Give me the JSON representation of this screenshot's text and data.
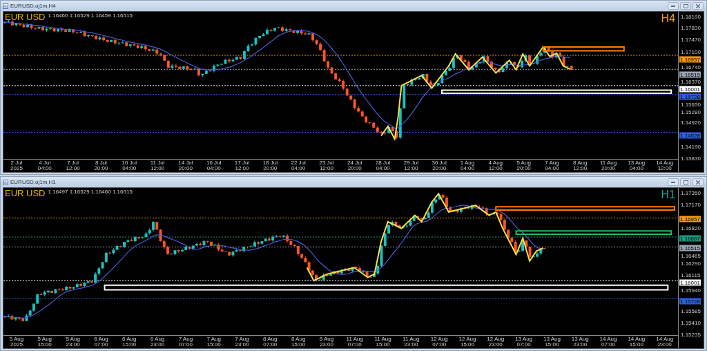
{
  "windows": [
    {
      "title": "EURUSD.oj1m,H4",
      "symbol": "EUR USD",
      "ohlc": "1.16460 1.16529 1.16459 1.16515",
      "timeframe": "H4",
      "price_axis": [
        {
          "kind": "tick",
          "value": "1.18190"
        },
        {
          "kind": "tick",
          "value": "1.17830"
        },
        {
          "kind": "tick",
          "value": "1.17470"
        },
        {
          "kind": "tick",
          "value": "1.17100"
        },
        {
          "kind": "tag",
          "value": "1.16957",
          "color": "#f59a00"
        },
        {
          "kind": "tick",
          "value": "1.16740"
        },
        {
          "kind": "tag",
          "value": "1.16515",
          "color": "#9aa4b4"
        },
        {
          "kind": "tick",
          "value": "1.16370"
        },
        {
          "kind": "tag",
          "value": "1.16001",
          "color": "#ffffff"
        },
        {
          "kind": "tag",
          "value": "1.15728",
          "color": "#2f5fe0"
        },
        {
          "kind": "tick",
          "value": "1.15650"
        },
        {
          "kind": "tick",
          "value": "1.15280"
        },
        {
          "kind": "tick",
          "value": "1.14920"
        },
        {
          "kind": "tag",
          "value": "1.14528",
          "color": "#2f5fe0"
        },
        {
          "kind": "tick",
          "value": "1.14190"
        },
        {
          "kind": "tick",
          "value": "1.13830"
        }
      ],
      "time_axis": [
        "2 Jul 2025",
        "4 Jul 04:00",
        "7 Jul 12:00",
        "8 Jul 20:00",
        "10 Jul 04:00",
        "11 Jul 12:00",
        "14 Jul 20:00",
        "16 Jul 04:00",
        "17 Jul 12:00",
        "18 Jul 20:00",
        "22 Jul 04:00",
        "23 Jul 12:00",
        "24 Jul 20:00",
        "28 Jul 04:00",
        "29 Jul 12:00",
        "30 Jul 20:00",
        "1 Aug 04:00",
        "4 Aug 12:00",
        "5 Aug 20:00",
        "7 Aug 04:00",
        "8 Aug 12:00",
        "11 Aug 20:00",
        "13 Aug 04:00",
        "14 Aug 12:00"
      ]
    },
    {
      "title": "EURUSD.oj1m,H1",
      "symbol": "EUR USD",
      "ohlc": "1.16497 1.16529 1.16460 1.16515",
      "timeframe": "H1",
      "price_axis": [
        {
          "kind": "tick",
          "value": "1.17350"
        },
        {
          "kind": "tick",
          "value": "1.17170"
        },
        {
          "kind": "tag",
          "value": "1.16957",
          "color": "#f59a00"
        },
        {
          "kind": "tick",
          "value": "1.16820"
        },
        {
          "kind": "tag",
          "value": "1.16667",
          "color": "#1a9a80"
        },
        {
          "kind": "tag",
          "value": "1.16515",
          "color": "#9aa4b4"
        },
        {
          "kind": "tick",
          "value": "1.16465"
        },
        {
          "kind": "tick",
          "value": "1.16290"
        },
        {
          "kind": "tick",
          "value": "1.16115"
        },
        {
          "kind": "tag",
          "value": "1.16001",
          "color": "#ffffff"
        },
        {
          "kind": "tick",
          "value": "1.15940"
        },
        {
          "kind": "tag",
          "value": "1.15728",
          "color": "#2f5fe0"
        },
        {
          "kind": "tick",
          "value": "1.15585"
        },
        {
          "kind": "tick",
          "value": "1.15410"
        },
        {
          "kind": "tick",
          "value": "1.15235"
        }
      ],
      "time_axis": [
        "5 Aug 2025",
        "5 Aug 15:00",
        "5 Aug 23:00",
        "6 Aug 07:00",
        "6 Aug 15:00",
        "6 Aug 23:00",
        "7 Aug 07:00",
        "7 Aug 15:00",
        "7 Aug 23:00",
        "8 Aug 07:00",
        "8 Aug 15:00",
        "8 Aug 23:00",
        "11 Aug 07:00",
        "11 Aug 15:00",
        "11 Aug 23:00",
        "12 Aug 07:00",
        "12 Aug 15:00",
        "12 Aug 23:00",
        "13 Aug 07:00",
        "13 Aug 15:00",
        "13 Aug 23:00",
        "14 Aug 07:00",
        "14 Aug 15:00",
        "14 Aug 23:00"
      ]
    }
  ]
}
